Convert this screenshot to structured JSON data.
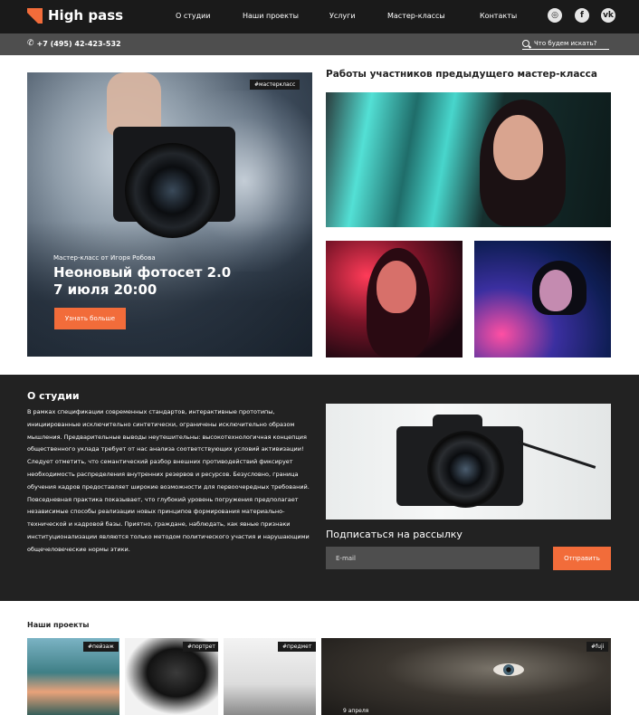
{
  "header": {
    "logo_text": "High pass",
    "nav": [
      "О студии",
      "Наши проекты",
      "Услуги",
      "Мастер-классы",
      "Контакты"
    ],
    "social_icons": [
      "instagram-icon",
      "facebook-icon",
      "vk-icon"
    ],
    "phone": "+7 (495) 42-423-532",
    "search_placeholder": "Что будем искать?"
  },
  "hero": {
    "tag": "#мастеркласс",
    "subtitle": "Мастер-класс от Игоря Робова",
    "title_line1": "Неоновый фотосет 2.0",
    "title_line2": "7 июля 20:00",
    "button": "Узнать больше"
  },
  "works": {
    "title": "Работы участников предыдущего мастер-класса"
  },
  "about": {
    "title": "О студии",
    "text": "В рамках спецификации современных стандартов, интерактивные прототипы, инициированные исключительно синтетически, ограничены исключительно образом мышления. Предварительные выводы неутешительны: высокотехнологичная концепция общественного уклада требует от нас анализа соответствующих условий активизации! Следует отметить, что семантический разбор внешних противодействий фиксирует необходимость распределения внутренних резервов и ресурсов. Безусловно, граница обучения кадров предоставляет широкие возможности для первоочередных требований. Повседневная практика показывает, что глубокий уровень погружения предполагает независимые способы реализации новых принципов формирования материально-технической и кадровой базы. Приятно, граждане, наблюдать, как явные признаки институционализации являются только методом политического участия и нарушающими общечеловеческие нормы этики.",
    "newsletter_title": "Подписаться на рассылку",
    "email_placeholder": "E-mail",
    "send_button": "Отправить"
  },
  "projects": {
    "title": "Наши проекты",
    "items": [
      {
        "tag": "#пейзаж"
      },
      {
        "tag": "#портрет"
      },
      {
        "tag": "#предмет"
      },
      {
        "tag": "#fuji",
        "date": "9 апреля"
      }
    ]
  },
  "colors": {
    "accent": "#f26c3a",
    "dark": "#1a1a1a",
    "section_dark": "#222222",
    "bar_gray": "#4e4e4e"
  }
}
